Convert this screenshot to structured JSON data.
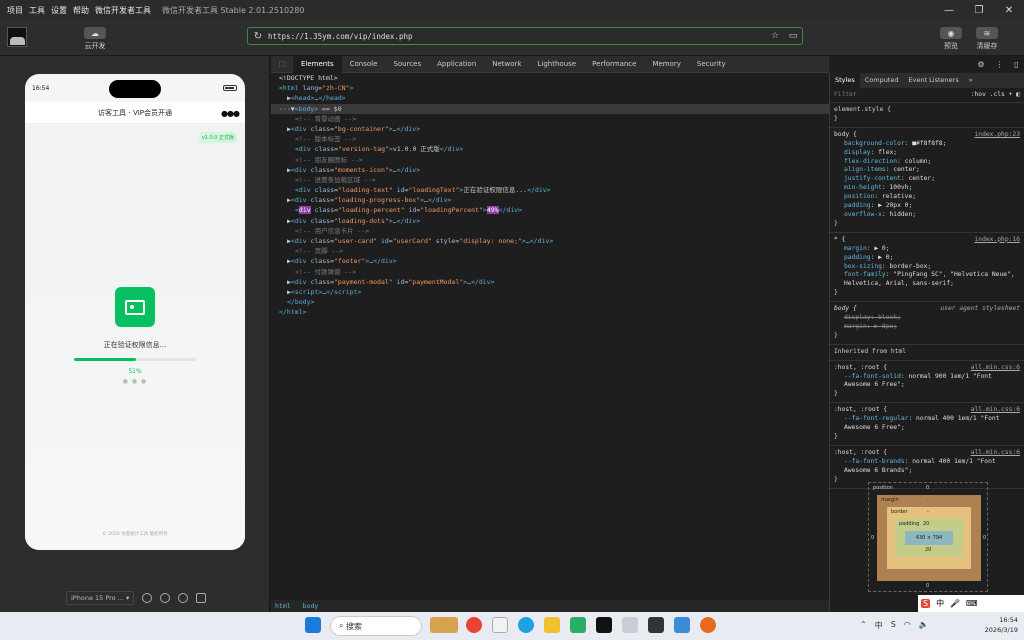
{
  "titlebar": {
    "menu": [
      "项目",
      "工具",
      "设置",
      "帮助",
      "微信开发者工具"
    ],
    "title": "微信开发者工具 Stable 2.01.2510280"
  },
  "toolbar": {
    "cloud_label": "云开发",
    "url": "https://1.35ym.com/vip/index.php",
    "preview_label": "预览",
    "cache_label": "清缓存"
  },
  "phone": {
    "time": "16:54",
    "nav_title": "访客工具 - VIP会员开通",
    "version_tag": "v1.0.0 正式版",
    "loading_text": "正在验证权限信息...",
    "progress_percent": "51%",
    "progress_value": 0.51,
    "footer": "© 2026 访客统计工具 版权所有"
  },
  "simbar": {
    "device": "iPhone 15 Pro ..."
  },
  "devtools": {
    "tabs": [
      "Elements",
      "Console",
      "Sources",
      "Application",
      "Network",
      "Lighthouse",
      "Performance",
      "Memory",
      "Security"
    ],
    "active_tab": "Elements",
    "breadcrumbs": [
      "html",
      "body"
    ]
  },
  "dom": [
    {
      "i": 0,
      "html": "<span class='tx'>&lt;!DOCTYPE html&gt;</span>"
    },
    {
      "i": 0,
      "html": "<span class='tg'>&lt;html</span> <span class='an'>lang</span>=<span class='av'>\"zh-CN\"</span><span class='tg'>&gt;</span>"
    },
    {
      "i": 1,
      "html": "▶<span class='tg'>&lt;head&gt;</span>…<span class='tg'>&lt;/head&gt;</span>"
    },
    {
      "i": 0,
      "sel": true,
      "html": "···▼<span class='tg'>&lt;body&gt;</span> == $0"
    },
    {
      "i": 2,
      "html": "<span class='cm'>&lt;!-- 背景动画 --&gt;</span>"
    },
    {
      "i": 1,
      "html": "▶<span class='tg'>&lt;div</span> <span class='an'>class</span>=<span class='av'>\"bg-container\"</span><span class='tg'>&gt;</span>…<span class='tg'>&lt;/div&gt;</span>"
    },
    {
      "i": 2,
      "html": "<span class='cm'>&lt;!-- 版本标签 --&gt;</span>"
    },
    {
      "i": 2,
      "html": "<span class='tg'>&lt;div</span> <span class='an'>class</span>=<span class='av'>\"version-tag\"</span><span class='tg'>&gt;</span>v1.0.0 正式版<span class='tg'>&lt;/div&gt;</span>"
    },
    {
      "i": 2,
      "html": "<span class='cm'>&lt;!-- 朋友圈图标 --&gt;</span>"
    },
    {
      "i": 1,
      "html": "▶<span class='tg'>&lt;div</span> <span class='an'>class</span>=<span class='av'>\"moments-icon\"</span><span class='tg'>&gt;</span>…<span class='tg'>&lt;/div&gt;</span>"
    },
    {
      "i": 2,
      "html": "<span class='cm'>&lt;!-- 进度条加载区域 --&gt;</span>"
    },
    {
      "i": 2,
      "html": "<span class='tg'>&lt;div</span> <span class='an'>class</span>=<span class='av'>\"loading-text\"</span> <span class='an'>id</span>=<span class='av'>\"loadingText\"</span><span class='tg'>&gt;</span>正在验证权限信息...<span class='tg'>&lt;/div&gt;</span>"
    },
    {
      "i": 1,
      "html": "▶<span class='tg'>&lt;div</span> <span class='an'>class</span>=<span class='av'>\"loading-progress-box\"</span><span class='tg'>&gt;</span>…<span class='tg'>&lt;/div&gt;</span>"
    },
    {
      "i": 2,
      "html": "<span class='tg'>&lt;<span class='hl'>div</span></span> <span class='an'>class</span>=<span class='av'>\"loading-percent\"</span> <span class='an'>id</span>=<span class='av'>\"loadingPercent\"</span><span class='tg'>&gt;</span><span class='hl'>49%</span><span class='tg'>&lt;/div&gt;</span>"
    },
    {
      "i": 1,
      "html": "▶<span class='tg'>&lt;div</span> <span class='an'>class</span>=<span class='av'>\"loading-dots\"</span><span class='tg'>&gt;</span>…<span class='tg'>&lt;/div&gt;</span>"
    },
    {
      "i": 2,
      "html": "<span class='cm'>&lt;!-- 用户信息卡片 --&gt;</span>"
    },
    {
      "i": 1,
      "html": "▶<span class='tg'>&lt;div</span> <span class='an'>class</span>=<span class='av'>\"user-card\"</span> <span class='an'>id</span>=<span class='av'>\"userCard\"</span> <span class='an'>style</span>=<span class='av'>\"display: none;\"</span><span class='tg'>&gt;</span>…<span class='tg'>&lt;/div&gt;</span>"
    },
    {
      "i": 2,
      "html": "<span class='cm'>&lt;!-- 页脚 --&gt;</span>"
    },
    {
      "i": 1,
      "html": "▶<span class='tg'>&lt;div</span> <span class='an'>class</span>=<span class='av'>\"footer\"</span><span class='tg'>&gt;</span>…<span class='tg'>&lt;/div&gt;</span>"
    },
    {
      "i": 2,
      "html": "<span class='cm'>&lt;!-- 付款弹窗 --&gt;</span>"
    },
    {
      "i": 1,
      "html": "▶<span class='tg'>&lt;div</span> <span class='an'>class</span>=<span class='av'>\"payment-modal\"</span> <span class='an'>id</span>=<span class='av'>\"paymentModal\"</span><span class='tg'>&gt;</span>…<span class='tg'>&lt;/div&gt;</span>"
    },
    {
      "i": 1,
      "html": "▶<span class='tg'>&lt;script&gt;</span>…<span class='tg'>&lt;/script&gt;</span>"
    },
    {
      "i": 1,
      "html": "<span class='tg'>&lt;/body&gt;</span>"
    },
    {
      "i": 0,
      "html": "<span class='tg'>&lt;/html&gt;</span>"
    }
  ],
  "styles": {
    "tabs": [
      "Styles",
      "Computed",
      "Event Listeners",
      "»"
    ],
    "filter_placeholder": "Filter",
    "filter_right": ":hov .cls + ◧",
    "element_style": "element.style {",
    "body_src": "index.php:23",
    "body_props": [
      [
        "background-color",
        "■#f8f8f8;"
      ],
      [
        "display",
        "flex;"
      ],
      [
        "flex-direction",
        "column;"
      ],
      [
        "align-items",
        "center;"
      ],
      [
        "justify-content",
        "center;"
      ],
      [
        "min-height",
        "100vh;"
      ],
      [
        "position",
        "relative;"
      ],
      [
        "padding",
        "▶ 20px 0;"
      ],
      [
        "overflow-x",
        "hidden;"
      ]
    ],
    "star_src": "index.php:16",
    "star_props": [
      [
        "margin",
        "▶ 0;"
      ],
      [
        "padding",
        "▶ 0;"
      ],
      [
        "box-sizing",
        "border-box;"
      ],
      [
        "font-family",
        "\"PingFang SC\", \"Helvetica Neue\", Helvetica, Arial, sans-serif;"
      ]
    ],
    "ua_label": "user agent stylesheet",
    "ua_props": [
      [
        "display",
        "block;"
      ],
      [
        "margin",
        "▶ 8px;"
      ]
    ],
    "inherited": "Inherited from html",
    "root_rules": [
      {
        "src": "all.min.css:6",
        "prop": "--fa-font-solid",
        "val": "normal 900 1em/1 \"Font Awesome 6 Free\";"
      },
      {
        "src": "all.min.css:6",
        "prop": "--fa-font-regular",
        "val": "normal 400 1em/1 \"Font Awesome 6 Free\";"
      },
      {
        "src": "all.min.css:6",
        "prop": "--fa-font-brands",
        "val": "normal 400 1em/1 \"Font Awesome 6 Brands\";"
      }
    ],
    "boxmodel": {
      "position_label": "position",
      "position_val": "0",
      "margin_label": "margin",
      "margin_val": "-",
      "border_label": "border",
      "border_val": "-",
      "padding_label": "padding",
      "padding_val": "20",
      "content": "430 × 794",
      "side_zero": "0"
    }
  },
  "taskbar": {
    "search": "搜索",
    "ime": "中",
    "clock": "16:54",
    "date": "2026/3/19"
  }
}
